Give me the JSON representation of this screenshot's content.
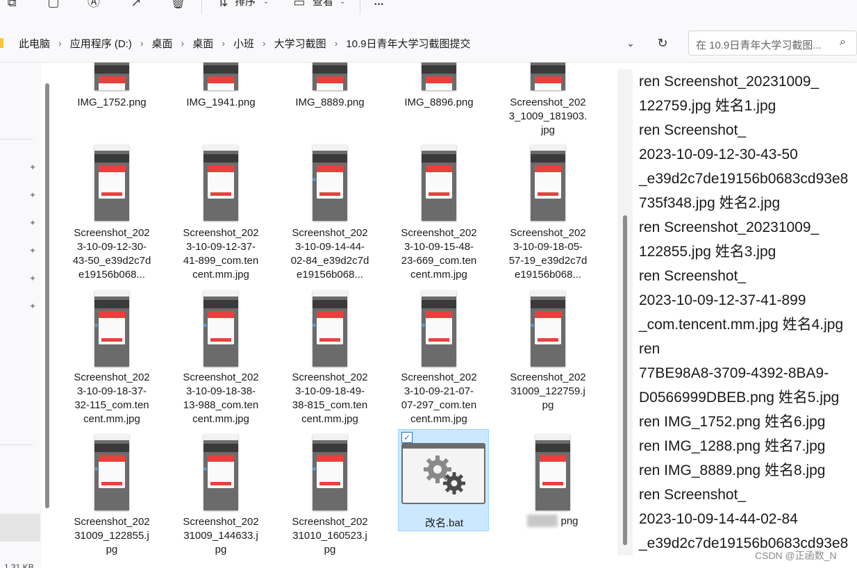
{
  "toolbar": {
    "sort_label": "排序",
    "view_label": "查看",
    "more_label": "…"
  },
  "address": {
    "crumbs": [
      "此电脑",
      "应用程序 (D:)",
      "桌面",
      "桌面",
      "小班",
      "大学习截图",
      "10.9日青年大学习截图提交"
    ],
    "search_placeholder": "在 10.9日青年大学习截图..."
  },
  "status": {
    "size_text": "1.31 KB"
  },
  "files": [
    {
      "name": "IMG_1752.png",
      "col": 0,
      "row": 0
    },
    {
      "name": "IMG_1941.png",
      "col": 1,
      "row": 0
    },
    {
      "name": "IMG_8889.png",
      "col": 2,
      "row": 0
    },
    {
      "name": "IMG_8896.png",
      "col": 3,
      "row": 0
    },
    {
      "name": "Screenshot_2023_1009_181903.jpg",
      "col": 4,
      "row": 0
    },
    {
      "name": "Screenshot_2023-10-09-12-30-43-50_e39d2c7de19156b068...",
      "col": 0,
      "row": 1
    },
    {
      "name": "Screenshot_2023-10-09-12-37-41-899_com.tencent.mm.jpg",
      "col": 1,
      "row": 1
    },
    {
      "name": "Screenshot_2023-10-09-14-44-02-84_e39d2c7de19156b068...",
      "col": 2,
      "row": 1
    },
    {
      "name": "Screenshot_2023-10-09-15-48-23-669_com.tencent.mm.jpg",
      "col": 3,
      "row": 1
    },
    {
      "name": "Screenshot_2023-10-09-18-05-57-19_e39d2c7de19156b068...",
      "col": 4,
      "row": 1
    },
    {
      "name": "Screenshot_2023-10-09-18-37-32-115_com.tencent.mm.jpg",
      "col": 0,
      "row": 2
    },
    {
      "name": "Screenshot_2023-10-09-18-38-13-988_com.tencent.mm.jpg",
      "col": 1,
      "row": 2
    },
    {
      "name": "Screenshot_2023-10-09-18-49-38-815_com.tencent.mm.jpg",
      "col": 2,
      "row": 2
    },
    {
      "name": "Screenshot_2023-10-09-21-07-07-297_com.tencent.mm.jpg",
      "col": 3,
      "row": 2
    },
    {
      "name": "Screenshot_20231009_122759.jpg",
      "col": 4,
      "row": 2
    },
    {
      "name": "Screenshot_20231009_122855.jpg",
      "col": 0,
      "row": 3
    },
    {
      "name": "Screenshot_20231009_144633.jpg",
      "col": 1,
      "row": 3
    },
    {
      "name": "Screenshot_20231010_160523.jpg",
      "col": 2,
      "row": 3
    }
  ],
  "selected_file": {
    "name": "改名.bat"
  },
  "blurred_file": {
    "name_suffix": "png"
  },
  "text_panel": {
    "lines": [
      "ren Screenshot_20231009_",
      "122759.jpg 姓名1.jpg",
      "ren Screenshot_",
      "2023-10-09-12-30-43-50",
      "_e39d2c7de19156b0683cd93e8",
      "735f348.jpg 姓名2.jpg",
      "ren Screenshot_20231009_",
      "122855.jpg 姓名3.jpg",
      "ren Screenshot_",
      "2023-10-09-12-37-41-899",
      "_com.tencent.mm.jpg 姓名4.jpg",
      "ren",
      "77BE98A8-3709-4392-8BA9-",
      "D0566999DBEB.png 姓名5.jpg",
      "ren IMG_1752.png 姓名6.jpg",
      "ren IMG_1288.png 姓名7.jpg",
      "ren IMG_8889.png 姓名8.jpg",
      "ren Screenshot_",
      "2023-10-09-14-44-02-84",
      "_e39d2c7de19156b0683cd93e8"
    ]
  },
  "watermark": "CSDN @正函数_N"
}
